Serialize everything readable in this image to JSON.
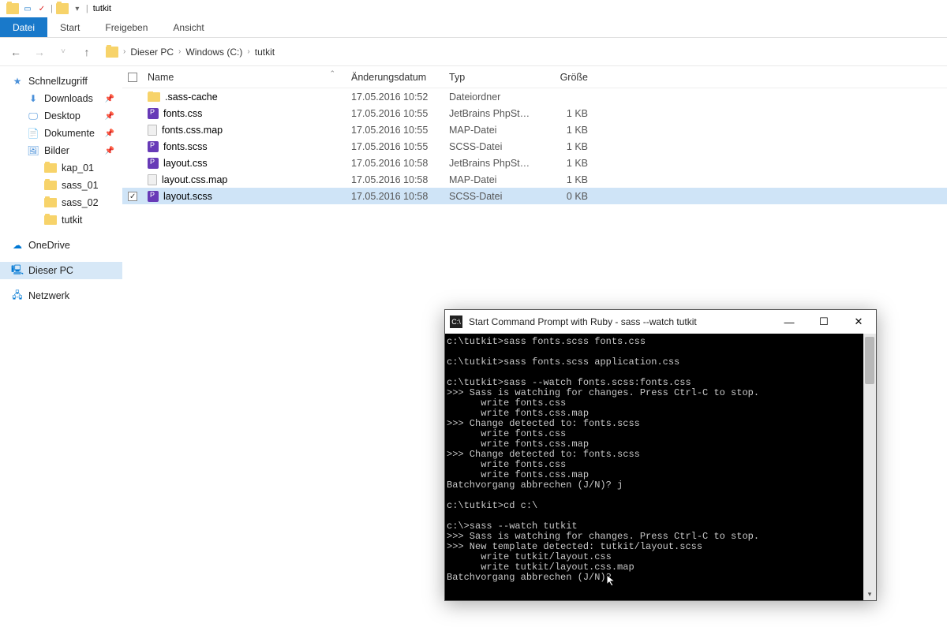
{
  "title": "tutkit",
  "ribbon": {
    "tabs": [
      "Datei",
      "Start",
      "Freigeben",
      "Ansicht"
    ],
    "active": "Datei"
  },
  "breadcrumbs": [
    "Dieser PC",
    "Windows (C:)",
    "tutkit"
  ],
  "columns": {
    "name": "Name",
    "date": "Änderungsdatum",
    "type": "Typ",
    "size": "Größe"
  },
  "sidebar": {
    "quickaccess": "Schnellzugriff",
    "items1": [
      {
        "label": "Downloads",
        "pin": true
      },
      {
        "label": "Desktop",
        "pin": true
      },
      {
        "label": "Dokumente",
        "pin": true
      },
      {
        "label": "Bilder",
        "pin": true
      },
      {
        "label": "kap_01",
        "pin": false
      },
      {
        "label": "sass_01",
        "pin": false
      },
      {
        "label": "sass_02",
        "pin": false
      },
      {
        "label": "tutkit",
        "pin": false
      }
    ],
    "onedrive": "OneDrive",
    "pc": "Dieser PC",
    "network": "Netzwerk"
  },
  "files": [
    {
      "name": ".sass-cache",
      "date": "17.05.2016 10:52",
      "type": "Dateiordner",
      "size": "",
      "icon": "folder",
      "sel": false
    },
    {
      "name": "fonts.css",
      "date": "17.05.2016 10:55",
      "type": "JetBrains PhpStorm",
      "size": "1 KB",
      "icon": "ps",
      "sel": false
    },
    {
      "name": "fonts.css.map",
      "date": "17.05.2016 10:55",
      "type": "MAP-Datei",
      "size": "1 KB",
      "icon": "file",
      "sel": false
    },
    {
      "name": "fonts.scss",
      "date": "17.05.2016 10:55",
      "type": "SCSS-Datei",
      "size": "1 KB",
      "icon": "ps",
      "sel": false
    },
    {
      "name": "layout.css",
      "date": "17.05.2016 10:58",
      "type": "JetBrains PhpStorm",
      "size": "1 KB",
      "icon": "ps",
      "sel": false
    },
    {
      "name": "layout.css.map",
      "date": "17.05.2016 10:58",
      "type": "MAP-Datei",
      "size": "1 KB",
      "icon": "file",
      "sel": false
    },
    {
      "name": "layout.scss",
      "date": "17.05.2016 10:58",
      "type": "SCSS-Datei",
      "size": "0 KB",
      "icon": "ps",
      "sel": true
    }
  ],
  "cmd": {
    "title": "Start Command Prompt with Ruby - sass  --watch tutkit",
    "lines": [
      "c:\\tutkit>sass fonts.scss fonts.css",
      "",
      "c:\\tutkit>sass fonts.scss application.css",
      "",
      "c:\\tutkit>sass --watch fonts.scss:fonts.css",
      ">>> Sass is watching for changes. Press Ctrl-C to stop.",
      "      write fonts.css",
      "      write fonts.css.map",
      ">>> Change detected to: fonts.scss",
      "      write fonts.css",
      "      write fonts.css.map",
      ">>> Change detected to: fonts.scss",
      "      write fonts.css",
      "      write fonts.css.map",
      "Batchvorgang abbrechen (J/N)? j",
      "",
      "c:\\tutkit>cd c:\\",
      "",
      "c:\\>sass --watch tutkit",
      ">>> Sass is watching for changes. Press Ctrl-C to stop.",
      ">>> New template detected: tutkit/layout.scss",
      "      write tutkit/layout.css",
      "      write tutkit/layout.css.map",
      "Batchvorgang abbrechen (J/N)?"
    ]
  }
}
